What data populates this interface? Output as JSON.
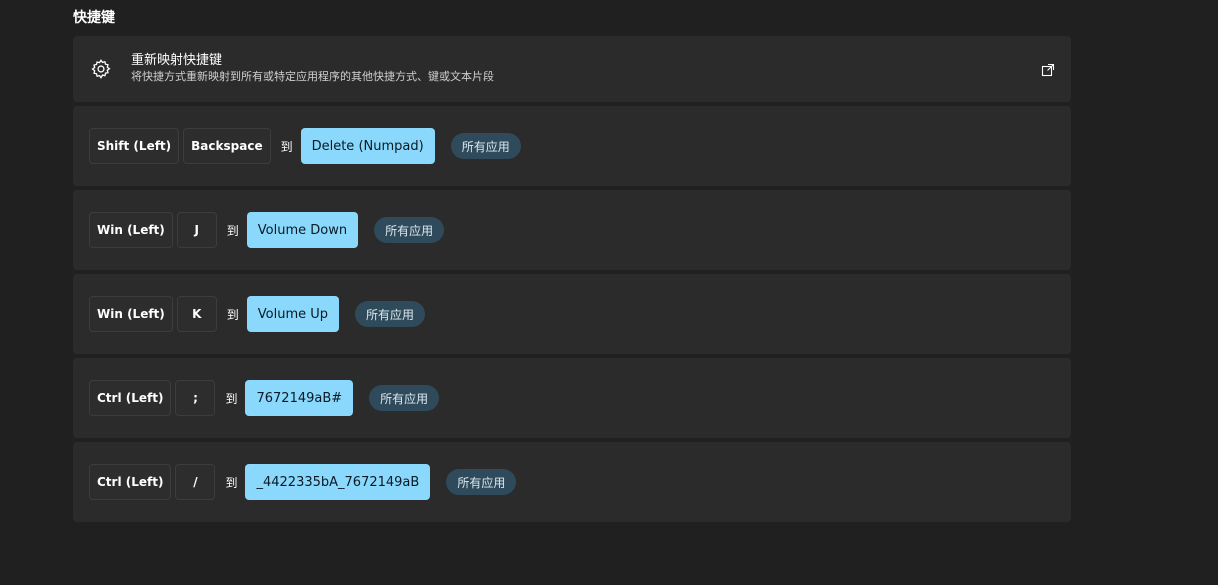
{
  "section": {
    "title": "快捷键"
  },
  "remap_card": {
    "icon": "gear-icon",
    "title": "重新映射快捷键",
    "description": "将快捷方式重新映射到所有或特定应用程序的其他快捷方式、键或文本片段",
    "external_icon": "open-external-icon"
  },
  "mappings": [
    {
      "keys": [
        "Shift (Left)",
        "Backspace"
      ],
      "to_label": "到",
      "target": "Delete (Numpad)",
      "scope": "所有应用"
    },
    {
      "keys": [
        "Win (Left)",
        "J"
      ],
      "to_label": "到",
      "target": "Volume Down",
      "scope": "所有应用"
    },
    {
      "keys": [
        "Win (Left)",
        "K"
      ],
      "to_label": "到",
      "target": "Volume Up",
      "scope": "所有应用"
    },
    {
      "keys": [
        "Ctrl (Left)",
        ";"
      ],
      "to_label": "到",
      "target": "7672149aB#",
      "scope": "所有应用"
    },
    {
      "keys": [
        "Ctrl (Left)",
        "/"
      ],
      "to_label": "到",
      "target": "_4422335bA_7672149aB",
      "scope": "所有应用"
    }
  ],
  "colors": {
    "background": "#202020",
    "card": "#2b2b2b",
    "target_fill": "#8ad8fb",
    "badge_fill": "#2f4a5a"
  }
}
